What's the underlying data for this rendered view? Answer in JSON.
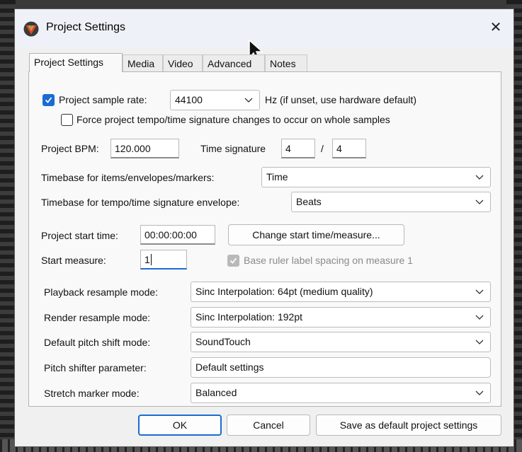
{
  "window": {
    "title": "Project Settings",
    "close": "✕"
  },
  "tabs": [
    {
      "label": "Project Settings",
      "active": true
    },
    {
      "label": "Media"
    },
    {
      "label": "Video"
    },
    {
      "label": "Advanced"
    },
    {
      "label": "Notes"
    }
  ],
  "sample_rate": {
    "checkbox_label": "Project sample rate:",
    "checked": true,
    "value": "44100",
    "hint": "Hz (if unset, use hardware default)"
  },
  "force_tempo": {
    "label": "Force project tempo/time signature changes to occur on whole samples",
    "checked": false
  },
  "bpm": {
    "label": "Project BPM:",
    "value": "120.000"
  },
  "time_signature": {
    "label": "Time signature",
    "numerator": "4",
    "separator": "/",
    "denominator": "4"
  },
  "timebase_items": {
    "label": "Timebase for items/envelopes/markers:",
    "value": "Time"
  },
  "timebase_tempo": {
    "label": "Timebase for tempo/time signature envelope:",
    "value": "Beats"
  },
  "start_time": {
    "label": "Project start time:",
    "value": "00:00:00:00",
    "button": "Change start time/measure..."
  },
  "start_measure": {
    "label": "Start measure:",
    "value": "1"
  },
  "base_ruler": {
    "label": "Base ruler label spacing on measure 1",
    "checked": true,
    "disabled": true
  },
  "playback_resample": {
    "label": "Playback resample mode:",
    "value": "Sinc Interpolation: 64pt (medium quality)"
  },
  "render_resample": {
    "label": "Render resample mode:",
    "value": "Sinc Interpolation: 192pt"
  },
  "pitch_shift": {
    "label": "Default pitch shift mode:",
    "value": "SoundTouch"
  },
  "pitch_param": {
    "label": "Pitch shifter parameter:",
    "value": "Default settings"
  },
  "stretch_marker": {
    "label": "Stretch marker mode:",
    "value": "Balanced"
  },
  "buttons": {
    "ok": "OK",
    "cancel": "Cancel",
    "save_default": "Save as default project settings"
  },
  "colors": {
    "accent": "#1a6cd1",
    "dialog_bg": "#f0f0f0",
    "panel_bg": "#f9f9f9"
  }
}
